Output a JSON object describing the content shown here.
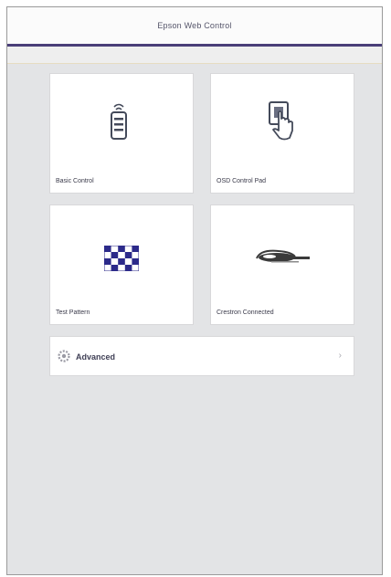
{
  "header": {
    "title": "Epson Web Control"
  },
  "tiles": [
    {
      "label": "Basic Control",
      "icon": "remote-control-icon"
    },
    {
      "label": "OSD Control Pad",
      "icon": "touch-pad-icon"
    },
    {
      "label": "Test Pattern",
      "icon": "checkerboard-icon"
    },
    {
      "label": "Crestron Connected",
      "icon": "crestron-logo"
    }
  ],
  "advanced": {
    "label": "Advanced",
    "icon": "gear-icon",
    "chevron": "›"
  },
  "colors": {
    "accent": "#4a3f78",
    "checker": "#2c2a8a",
    "background": "#e3e4e6"
  }
}
